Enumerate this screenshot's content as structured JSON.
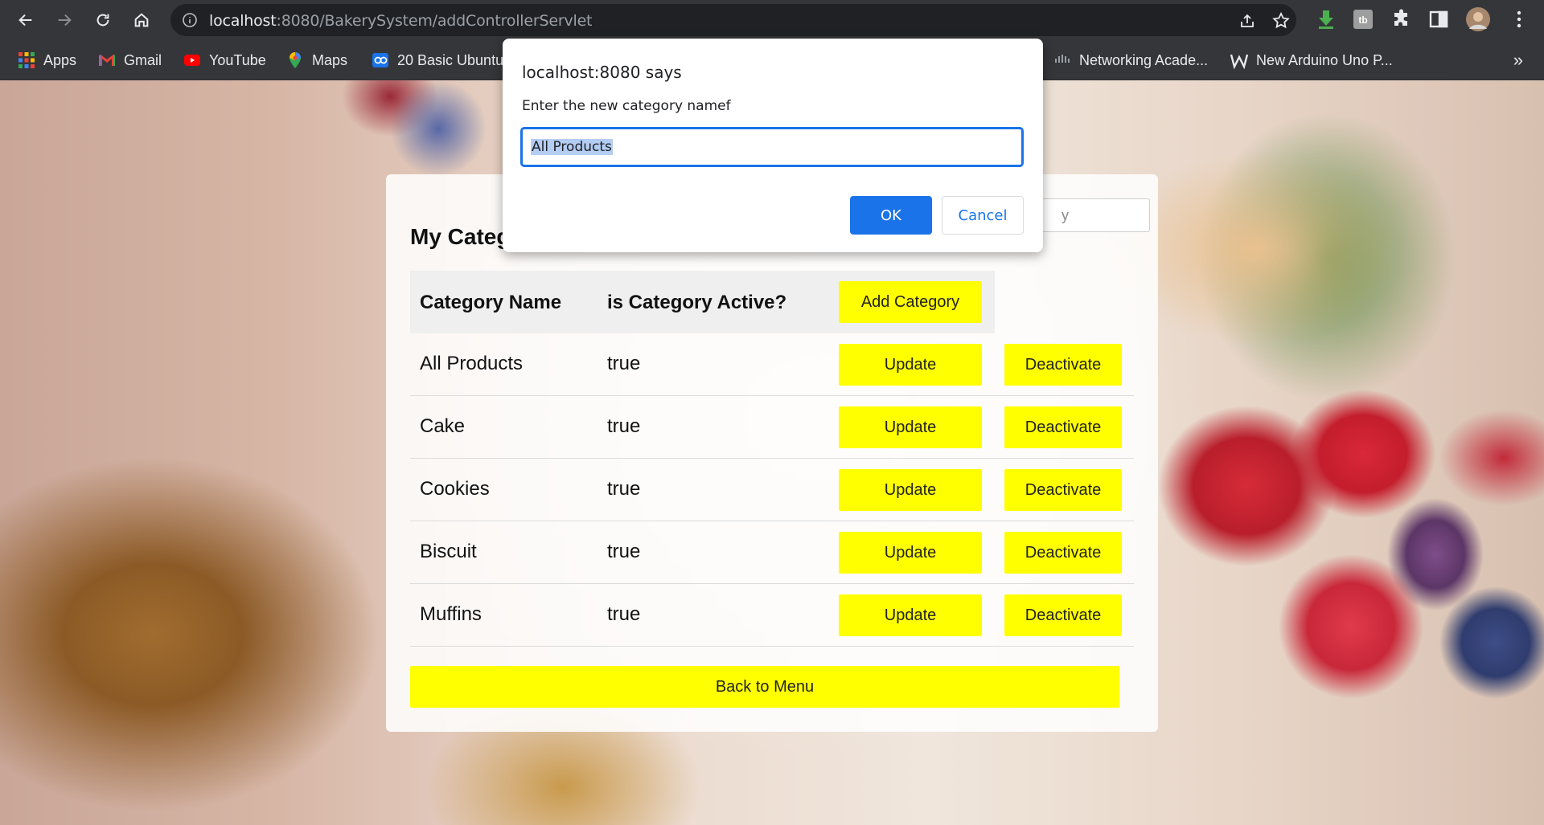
{
  "browser": {
    "url_host": "localhost",
    "url_path": ":8080/BakerySystem/addControllerServlet",
    "bookmarks": [
      {
        "label": "Apps",
        "icon": "apps-grid-icon"
      },
      {
        "label": "Gmail",
        "icon": "gmail-icon"
      },
      {
        "label": "YouTube",
        "icon": "youtube-icon"
      },
      {
        "label": "Maps",
        "icon": "maps-pin-icon"
      },
      {
        "label": "20 Basic Ubuntu",
        "icon": "site-icon"
      },
      {
        "label": "Networking Acade...",
        "icon": "cisco-icon"
      },
      {
        "label": "New Arduino Uno P...",
        "icon": "w-icon"
      }
    ],
    "more_bookmarks": "»"
  },
  "page": {
    "title": "My Categ",
    "search_placeholder_visible": "y",
    "table": {
      "headers": {
        "name": "Category Name",
        "active": "is Category Active?"
      },
      "add_button": "Add Category",
      "rows": [
        {
          "name": "All Products",
          "active": "true",
          "update": "Update",
          "deactivate": "Deactivate"
        },
        {
          "name": "Cake",
          "active": "true",
          "update": "Update",
          "deactivate": "Deactivate"
        },
        {
          "name": "Cookies",
          "active": "true",
          "update": "Update",
          "deactivate": "Deactivate"
        },
        {
          "name": "Biscuit",
          "active": "true",
          "update": "Update",
          "deactivate": "Deactivate"
        },
        {
          "name": "Muffins",
          "active": "true",
          "update": "Update",
          "deactivate": "Deactivate"
        }
      ]
    },
    "back_button": "Back to Menu"
  },
  "dialog": {
    "title": "localhost:8080 says",
    "message": "Enter the new category namef",
    "input_value": "All Products",
    "ok": "OK",
    "cancel": "Cancel"
  },
  "colors": {
    "accent": "#1a73e8",
    "button_yellow": "#ffff00"
  }
}
